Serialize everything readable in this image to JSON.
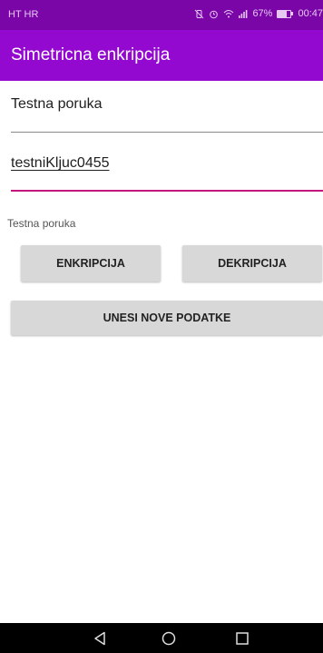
{
  "status_bar": {
    "carrier": "HT HR",
    "battery_percent": "67%",
    "battery_level": 0.67,
    "time": "00:47",
    "icons": [
      "mute-vibrate-icon",
      "alarm-icon",
      "wifi-icon",
      "signal-icon",
      "battery-icon"
    ]
  },
  "app_bar": {
    "title": "Simetricna enkripcija"
  },
  "form": {
    "message_value": "Testna poruka",
    "key_value": "testniKljuc0455"
  },
  "result": {
    "text": "Testna poruka"
  },
  "buttons": {
    "encrypt": "ENKRIPCIJA",
    "decrypt": "DEKRIPCIJA",
    "new_data": "UNESI NOVE PODATKE"
  },
  "navigation": {
    "icons": [
      "back-icon",
      "home-icon",
      "recents-icon"
    ]
  },
  "colors": {
    "status_bar": "#7a06a8",
    "app_bar": "#9409d0",
    "accent": "#c2187e",
    "button": "#d8d8d8"
  }
}
